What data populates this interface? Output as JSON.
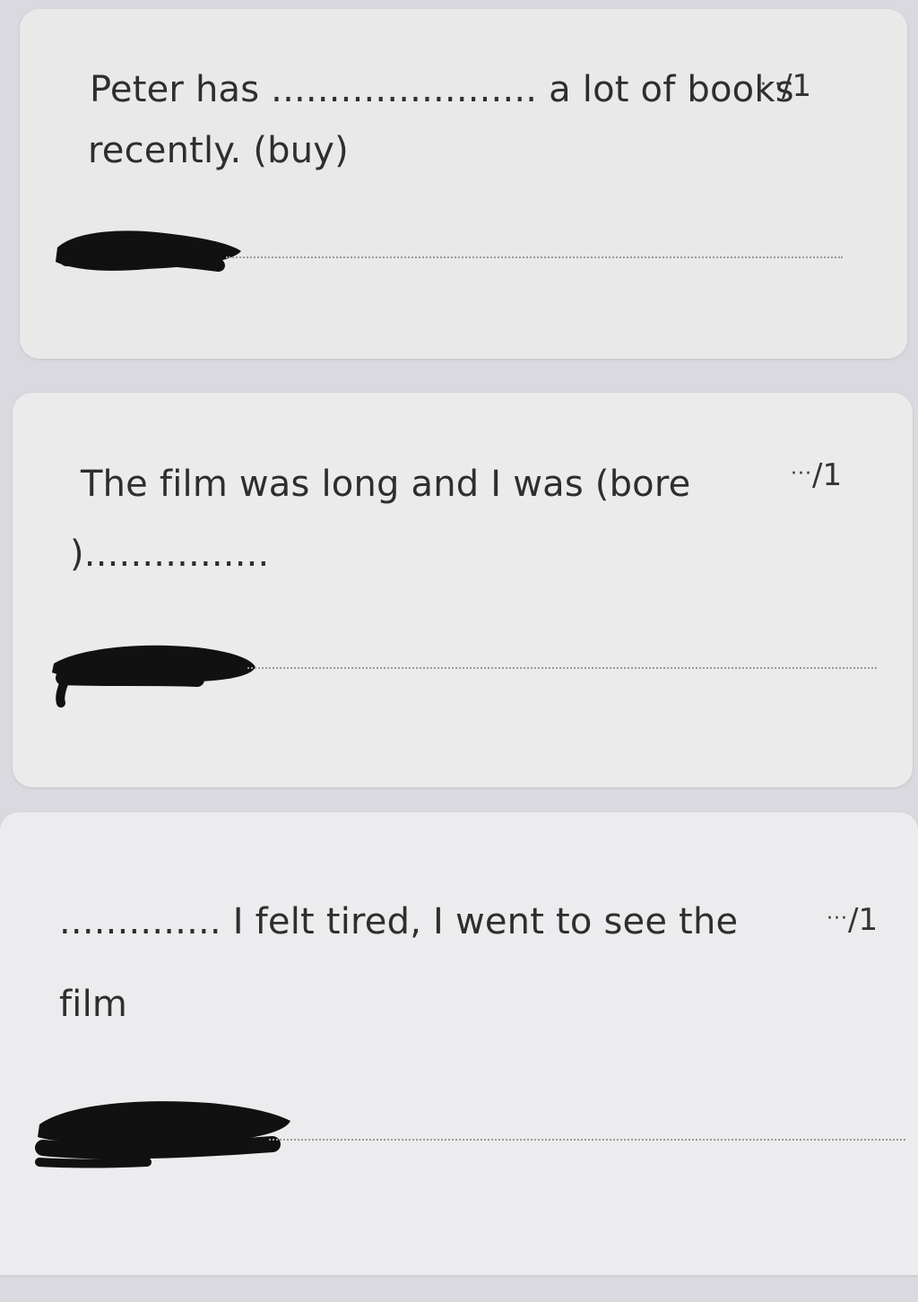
{
  "questions": [
    {
      "line1": "Peter has ....................... a lot of books",
      "line2": "recently. (buy)",
      "points": "/1",
      "answer_placeholder": ""
    },
    {
      "line1": "The film was long and I was (bore",
      "line2": ")................",
      "points": "/1",
      "answer_placeholder": ""
    },
    {
      "line1": ".............. I felt tired, I went to see the",
      "line2": "film",
      "points": "/1",
      "answer_placeholder": ""
    }
  ],
  "points_dots": "···",
  "colors": {
    "background": "#d9d9df",
    "card": "#ececed",
    "text": "#2e2e2e",
    "redaction": "#111111"
  }
}
